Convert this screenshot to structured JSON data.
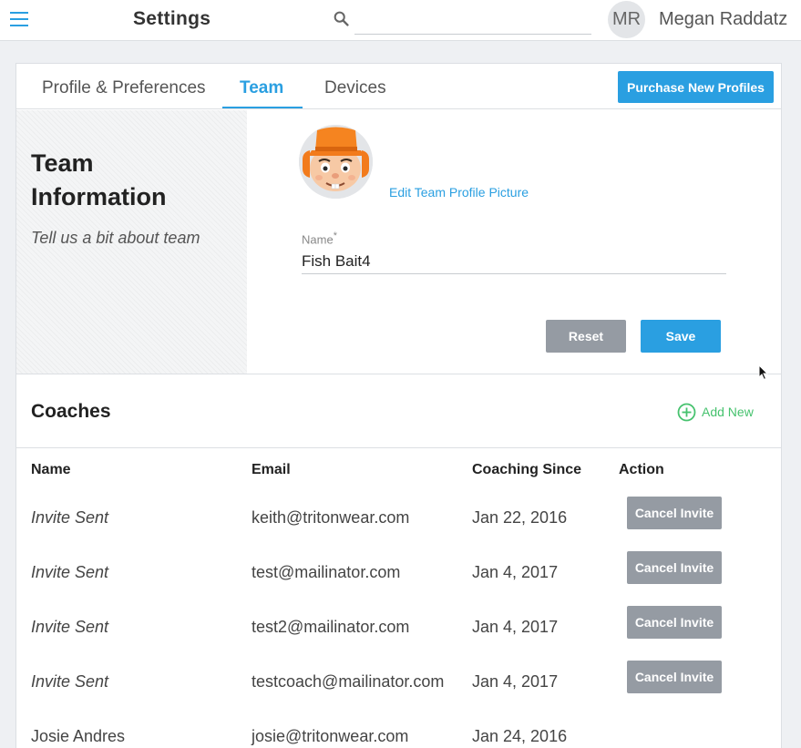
{
  "header": {
    "title": "Settings",
    "search_placeholder": "",
    "avatar_initials": "MR",
    "user_name": "Megan Raddatz"
  },
  "tabs": [
    {
      "label": "Profile & Preferences",
      "active": false
    },
    {
      "label": "Team",
      "active": true
    },
    {
      "label": "Devices",
      "active": false
    }
  ],
  "purchase_button": "Purchase New Profiles",
  "team_info": {
    "title": "Team Information",
    "subtitle": "Tell us a bit about team",
    "edit_picture_link": "Edit Team Profile Picture",
    "name_label": "Name",
    "required_marker": "*",
    "name_value": "Fish Bait4",
    "reset_button": "Reset",
    "save_button": "Save"
  },
  "coaches": {
    "title": "Coaches",
    "add_new": "Add New",
    "columns": [
      "Name",
      "Email",
      "Coaching Since",
      "Action"
    ],
    "rows": [
      {
        "name": "Invite Sent",
        "email": "keith@tritonwear.com",
        "since": "Jan 22, 2016",
        "action": "Cancel Invite",
        "pending": true
      },
      {
        "name": "Invite Sent",
        "email": "test@mailinator.com",
        "since": "Jan 4, 2017",
        "action": "Cancel Invite",
        "pending": true
      },
      {
        "name": "Invite Sent",
        "email": "test2@mailinator.com",
        "since": "Jan 4, 2017",
        "action": "Cancel Invite",
        "pending": true
      },
      {
        "name": "Invite Sent",
        "email": "testcoach@mailinator.com",
        "since": "Jan 4, 2017",
        "action": "Cancel Invite",
        "pending": true
      },
      {
        "name": "Josie Andres",
        "email": "josie@tritonwear.com",
        "since": "Jan 24, 2016",
        "action": "",
        "pending": false
      }
    ]
  },
  "colors": {
    "accent": "#2a9fe1",
    "success": "#46c26e",
    "muted_button": "#959ba3"
  }
}
